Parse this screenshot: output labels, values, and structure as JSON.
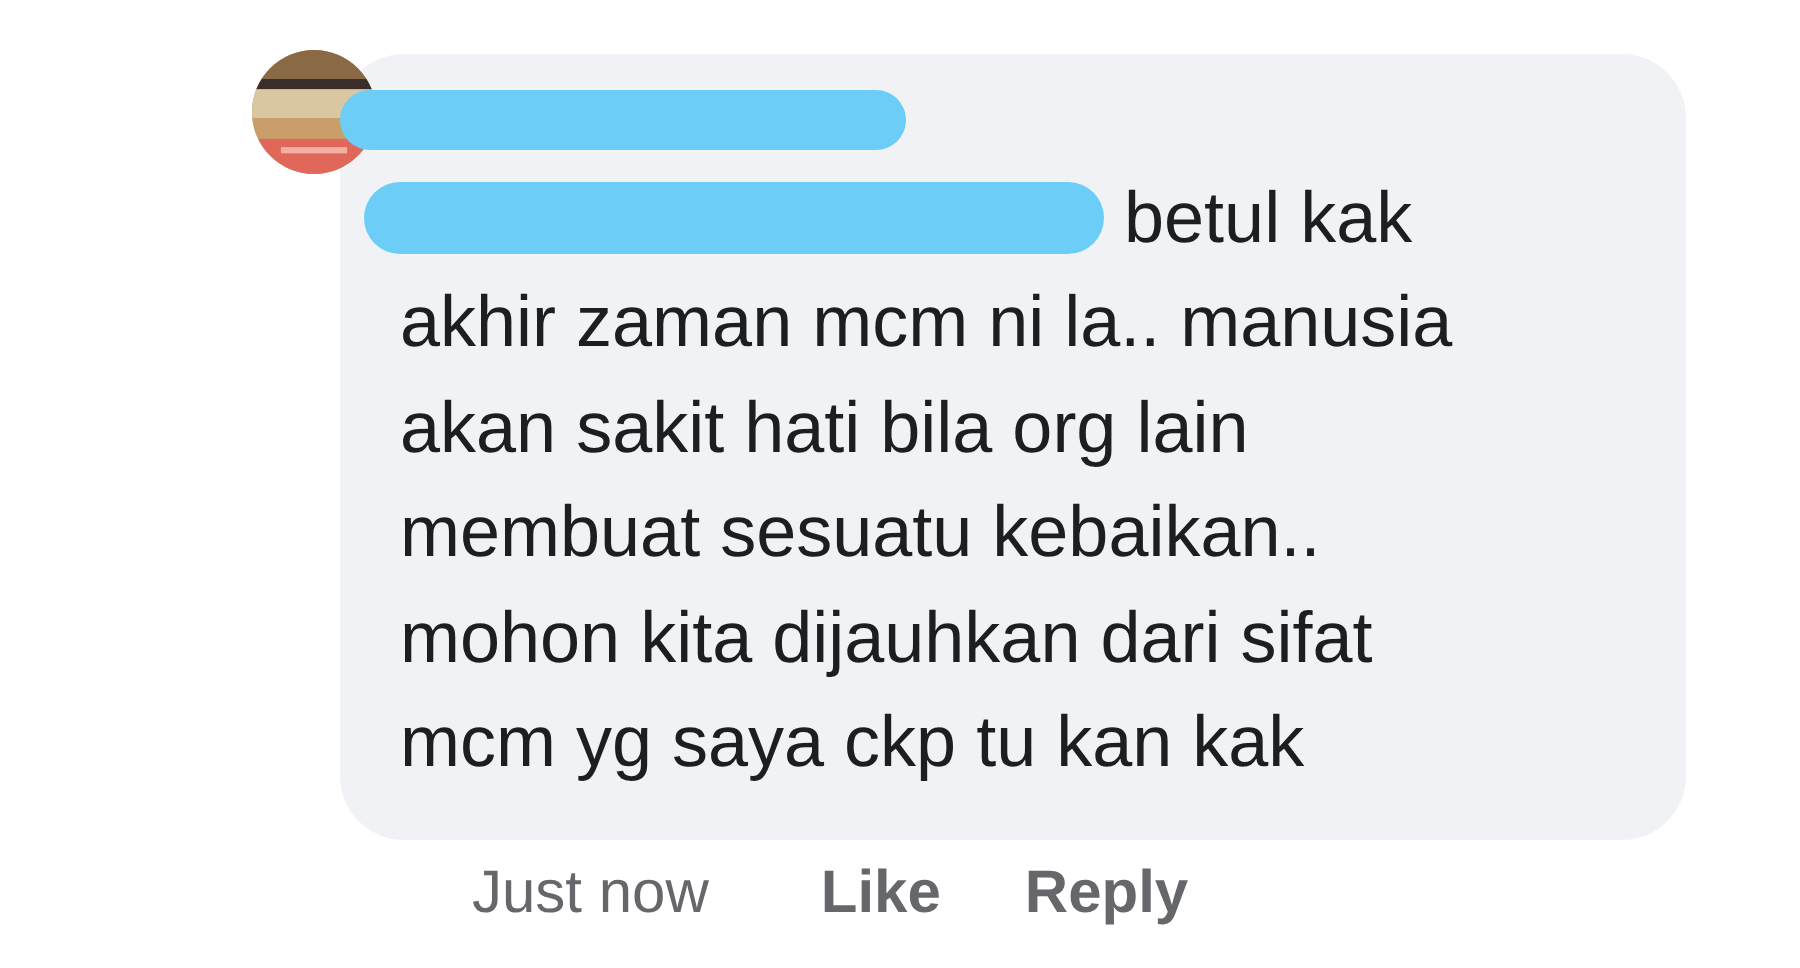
{
  "comment": {
    "lines": [
      "betul kak",
      "akhir zaman mcm ni la.. manusia",
      "akan sakit hati bila org lain",
      "membuat sesuatu kebaikan..",
      "mohon kita dijauhkan dari sifat",
      "mcm yg saya ckp tu kan kak"
    ],
    "timestamp": "Just now",
    "actions": [
      "Like",
      "Reply"
    ]
  }
}
